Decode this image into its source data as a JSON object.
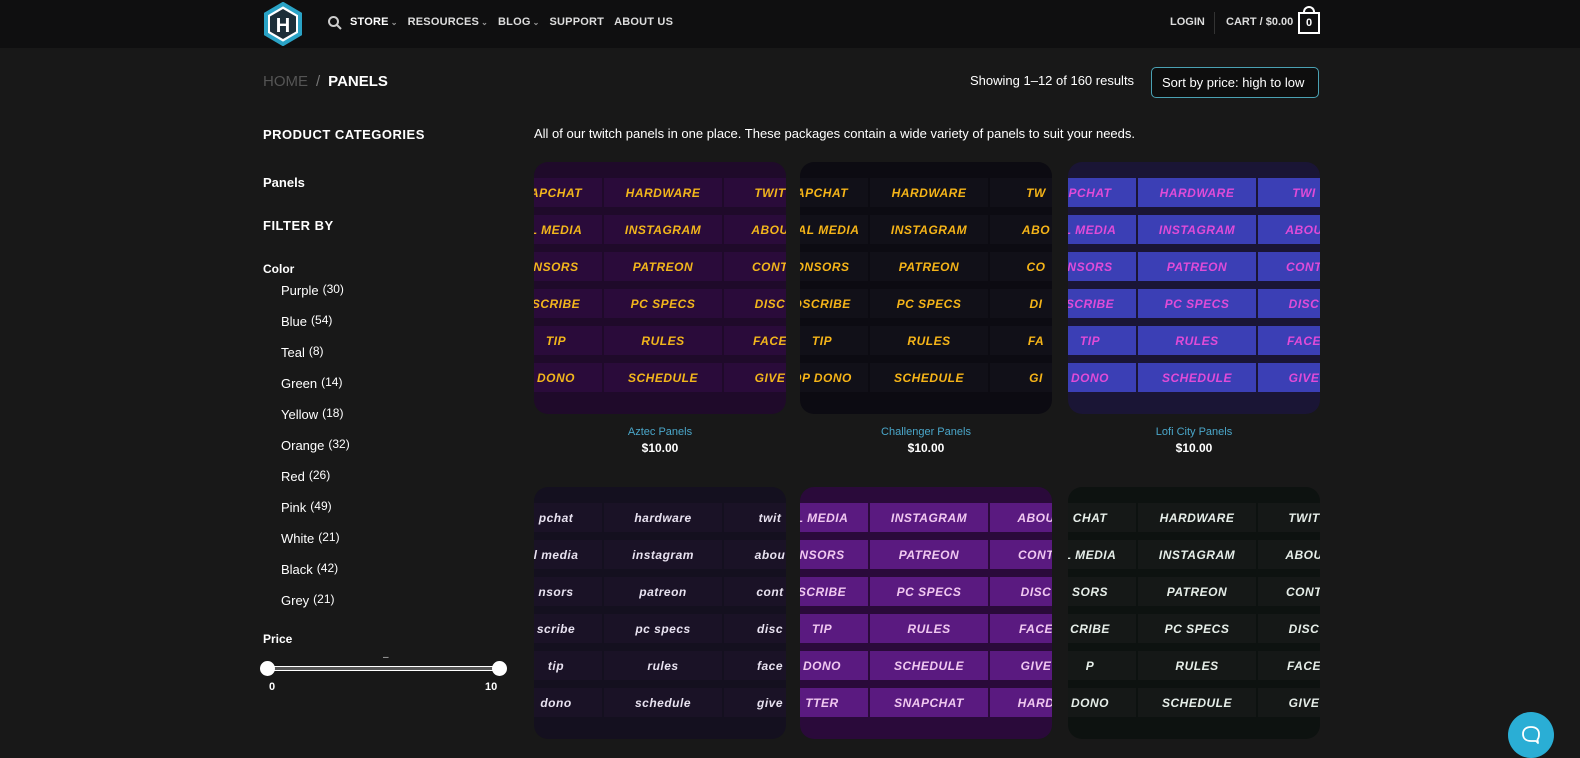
{
  "header": {
    "logo_letter": "H",
    "nav": [
      {
        "label": "STORE",
        "has_dropdown": true
      },
      {
        "label": "RESOURCES",
        "has_dropdown": true
      },
      {
        "label": "BLOG",
        "has_dropdown": true
      },
      {
        "label": "SUPPORT",
        "has_dropdown": false
      },
      {
        "label": "ABOUT US",
        "has_dropdown": false
      }
    ],
    "login": "LOGIN",
    "cart_label": "CART / $0.00",
    "cart_count": "0"
  },
  "breadcrumb": {
    "home": "HOME",
    "separator": "/",
    "current": "PANELS"
  },
  "results": {
    "text": "Showing 1–12 of 160 results",
    "sort_selected": "Sort by price: high to low"
  },
  "sidebar": {
    "categories_heading": "PRODUCT CATEGORIES",
    "category": "Panels",
    "filter_heading": "FILTER BY",
    "color_heading": "Color",
    "colors": [
      {
        "name": "Purple",
        "count": "(30)"
      },
      {
        "name": "Blue",
        "count": "(54)"
      },
      {
        "name": "Teal",
        "count": "(8)"
      },
      {
        "name": "Green",
        "count": "(14)"
      },
      {
        "name": "Yellow",
        "count": "(18)"
      },
      {
        "name": "Orange",
        "count": "(32)"
      },
      {
        "name": "Red",
        "count": "(26)"
      },
      {
        "name": "Pink",
        "count": "(49)"
      },
      {
        "name": "White",
        "count": "(21)"
      },
      {
        "name": "Black",
        "count": "(42)"
      },
      {
        "name": "Grey",
        "count": "(21)"
      }
    ],
    "price_heading": "Price",
    "price_separator": "–",
    "price_min": "0",
    "price_max": "10"
  },
  "intro": "All of our twitch panels in one place. These packages contain a wide variety of panels to suit your needs.",
  "products": [
    {
      "title": "Aztec Panels",
      "price": "$10.00",
      "bg": "#1f0a2a",
      "cell_bg": "#2a0b3a",
      "text_color": "#f2b61c",
      "cells": [
        "APCHAT",
        "HARDWARE",
        "TWIT",
        "L MEDIA",
        "INSTAGRAM",
        "ABOU",
        "NSORS",
        "PATREON",
        "CONT",
        "SCRIBE",
        "PC SPECS",
        "DISC",
        "TIP",
        "RULES",
        "FACE",
        "DONO",
        "SCHEDULE",
        "GIVE"
      ]
    },
    {
      "title": "Challenger Panels",
      "price": "$10.00",
      "bg": "#0c0b12",
      "cell_bg": "#111018",
      "text_color": "#f5b418",
      "cells": [
        "APCHAT",
        "HARDWARE",
        "TW",
        "CIAL MEDIA",
        "INSTAGRAM",
        "ABO",
        "ONSORS",
        "PATREON",
        "CO",
        "DSCRIBE",
        "PC SPECS",
        "DI",
        "TIP",
        "RULES",
        "FA",
        "OP DONO",
        "SCHEDULE",
        "GI"
      ]
    },
    {
      "title": "Lofi City Panels",
      "price": "$10.00",
      "bg": "#1a1535",
      "cell_bg": "#3b3fb5",
      "text_color": "#e04bd8",
      "cells": [
        "PCHAT",
        "HARDWARE",
        "TWI",
        "L MEDIA",
        "INSTAGRAM",
        "ABOU",
        "NSORS",
        "PATREON",
        "CONT",
        "SCRIBE",
        "PC SPECS",
        "DISC",
        "TIP",
        "RULES",
        "FACE",
        "DONO",
        "SCHEDULE",
        "GIVE"
      ]
    },
    {
      "title": "",
      "price": "",
      "bg": "#14101f",
      "cell_bg": "#1a1226",
      "text_color": "#e8e2f0",
      "cells": [
        "pchat",
        "hardware",
        "twit",
        "l media",
        "instagram",
        "abou",
        "nsors",
        "patreon",
        "cont",
        "scribe",
        "pc specs",
        "disc",
        "tip",
        "rules",
        "face",
        "dono",
        "schedule",
        "give"
      ]
    },
    {
      "title": "",
      "price": "",
      "bg": "#2a0a3a",
      "cell_bg": "#5a1a80",
      "text_color": "#f0c8f0",
      "cells": [
        "L MEDIA",
        "INSTAGRAM",
        "ABOU",
        "NSORS",
        "PATREON",
        "CONT",
        "SCRIBE",
        "PC SPECS",
        "DISC",
        "TIP",
        "RULES",
        "FACE",
        "DONO",
        "SCHEDULE",
        "GIVE",
        "TTER",
        "SNAPCHAT",
        "HARD"
      ]
    },
    {
      "title": "",
      "price": "",
      "bg": "#0d1210",
      "cell_bg": "#151817",
      "text_color": "#e6eee9",
      "cells": [
        "CHAT",
        "HARDWARE",
        "TWIT",
        "L MEDIA",
        "INSTAGRAM",
        "ABOU",
        "SORS",
        "PATREON",
        "CONT",
        "CRIBE",
        "PC SPECS",
        "DISC",
        "P",
        "RULES",
        "FACE",
        "DONO",
        "SCHEDULE",
        "GIVE"
      ]
    }
  ],
  "chat_widget": {
    "icon": "chat-bubble-icon"
  }
}
